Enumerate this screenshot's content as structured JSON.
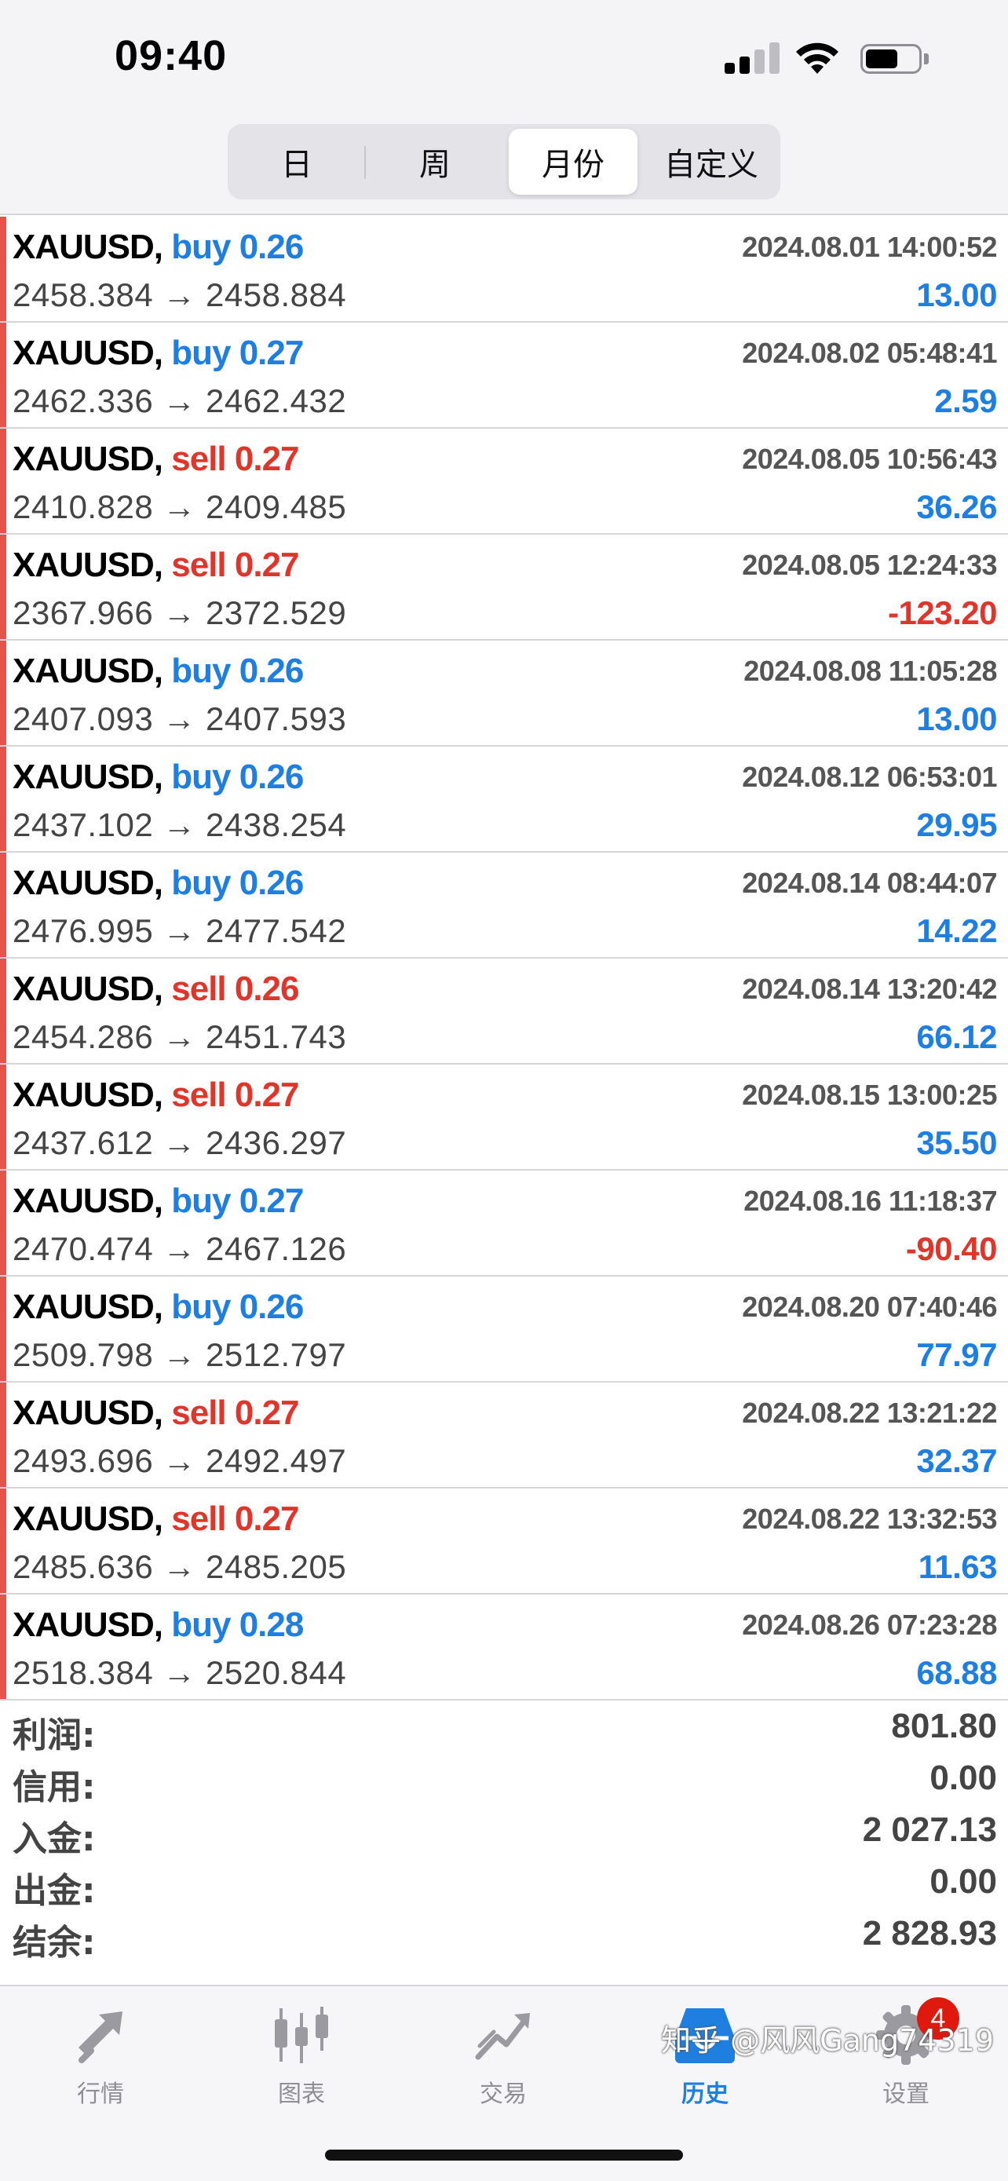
{
  "status": {
    "time": "09:40"
  },
  "periods": [
    "日",
    "周",
    "月份",
    "自定义"
  ],
  "trades": [
    {
      "symbol": "XAUUSD,",
      "side": "buy 0.26",
      "time": "2024.08.01 14:00:52",
      "prices": "2458.384 → 2458.884",
      "profit": "13.00"
    },
    {
      "symbol": "XAUUSD,",
      "side": "buy 0.27",
      "time": "2024.08.02 05:48:41",
      "prices": "2462.336 → 2462.432",
      "profit": "2.59"
    },
    {
      "symbol": "XAUUSD,",
      "side": "sell 0.27",
      "time": "2024.08.05 10:56:43",
      "prices": "2410.828 → 2409.485",
      "profit": "36.26"
    },
    {
      "symbol": "XAUUSD,",
      "side": "sell 0.27",
      "time": "2024.08.05 12:24:33",
      "prices": "2367.966 → 2372.529",
      "profit": "-123.20"
    },
    {
      "symbol": "XAUUSD,",
      "side": "buy 0.26",
      "time": "2024.08.08 11:05:28",
      "prices": "2407.093 → 2407.593",
      "profit": "13.00"
    },
    {
      "symbol": "XAUUSD,",
      "side": "buy 0.26",
      "time": "2024.08.12 06:53:01",
      "prices": "2437.102 → 2438.254",
      "profit": "29.95"
    },
    {
      "symbol": "XAUUSD,",
      "side": "buy 0.26",
      "time": "2024.08.14 08:44:07",
      "prices": "2476.995 → 2477.542",
      "profit": "14.22"
    },
    {
      "symbol": "XAUUSD,",
      "side": "sell 0.26",
      "time": "2024.08.14 13:20:42",
      "prices": "2454.286 → 2451.743",
      "profit": "66.12"
    },
    {
      "symbol": "XAUUSD,",
      "side": "sell 0.27",
      "time": "2024.08.15 13:00:25",
      "prices": "2437.612 → 2436.297",
      "profit": "35.50"
    },
    {
      "symbol": "XAUUSD,",
      "side": "buy 0.27",
      "time": "2024.08.16 11:18:37",
      "prices": "2470.474 → 2467.126",
      "profit": "-90.40"
    },
    {
      "symbol": "XAUUSD,",
      "side": "buy 0.26",
      "time": "2024.08.20 07:40:46",
      "prices": "2509.798 → 2512.797",
      "profit": "77.97"
    },
    {
      "symbol": "XAUUSD,",
      "side": "sell 0.27",
      "time": "2024.08.22 13:21:22",
      "prices": "2493.696 → 2492.497",
      "profit": "32.37"
    },
    {
      "symbol": "XAUUSD,",
      "side": "sell 0.27",
      "time": "2024.08.22 13:32:53",
      "prices": "2485.636 → 2485.205",
      "profit": "11.63"
    },
    {
      "symbol": "XAUUSD,",
      "side": "buy 0.28",
      "time": "2024.08.26 07:23:28",
      "prices": "2518.384 → 2520.844",
      "profit": "68.88"
    }
  ],
  "summary": {
    "profit_label": "利润:",
    "profit": "801.80",
    "credit_label": "信用:",
    "credit": "0.00",
    "deposit_label": "入金:",
    "deposit": "2 027.13",
    "withdrawal_label": "出金:",
    "withdrawal": "0.00",
    "balance_label": "结余:",
    "balance": "2 828.93"
  },
  "tabs": {
    "quotes": "行情",
    "chart": "图表",
    "trade": "交易",
    "history": "历史",
    "settings": "设置",
    "settings_badge": "4"
  },
  "watermark": "知乎 @风风Gang74319",
  "colors": {
    "buy": "#1e7fe0",
    "sell": "#e0352b",
    "accent": "#1e7fe0",
    "badge": "#e0190f"
  }
}
